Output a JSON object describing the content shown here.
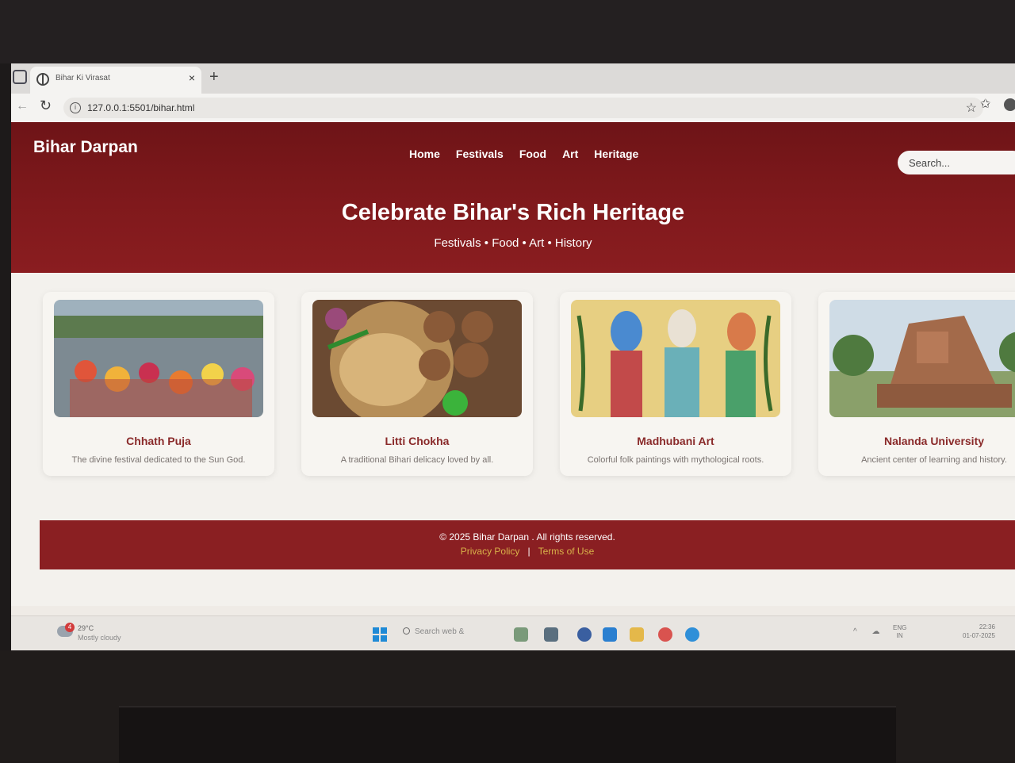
{
  "browser": {
    "tab_title": "Bihar Ki Virasat",
    "tab_close": "×",
    "new_tab": "+",
    "url": "127.0.0.1:5501/bihar.html"
  },
  "site": {
    "brand": "Bihar Darpan",
    "nav": [
      "Home",
      "Festivals",
      "Food",
      "Art",
      "Heritage"
    ],
    "search_placeholder": "Search...",
    "hero_title": "Celebrate Bihar's Rich Heritage",
    "hero_subtitle": "Festivals • Food • Art • History",
    "cards": [
      {
        "title": "Chhath Puja",
        "desc": "The divine festival dedicated to the Sun God."
      },
      {
        "title": "Litti Chokha",
        "desc": "A traditional Bihari delicacy loved by all."
      },
      {
        "title": "Madhubani Art",
        "desc": "Colorful folk paintings with mythological roots."
      },
      {
        "title": "Nalanda University",
        "desc": "Ancient center of learning and history."
      }
    ],
    "footer": {
      "copyright": "© 2025 Bihar Darpan . All rights reserved.",
      "privacy": "Privacy Policy",
      "separator": "|",
      "terms": "Terms of Use"
    }
  },
  "taskbar": {
    "weather_badge": "4",
    "weather_temp": "29°C",
    "weather_desc": "Mostly cloudy",
    "search_text": "Search web &",
    "lang_line1": "ENG",
    "lang_line2": "IN",
    "time": "22:36",
    "date": "01-07-2025"
  },
  "colors": {
    "header_bg": "#7a181b",
    "footer_bg": "#8a1f22",
    "card_title": "#8a2a2a",
    "footer_link": "#d9b24a"
  },
  "icons": [
    "window-icon",
    "globe-icon",
    "info-icon",
    "star-icon",
    "favorites-icon",
    "profile-icon",
    "weather-icon",
    "start-icon",
    "search-icon"
  ]
}
